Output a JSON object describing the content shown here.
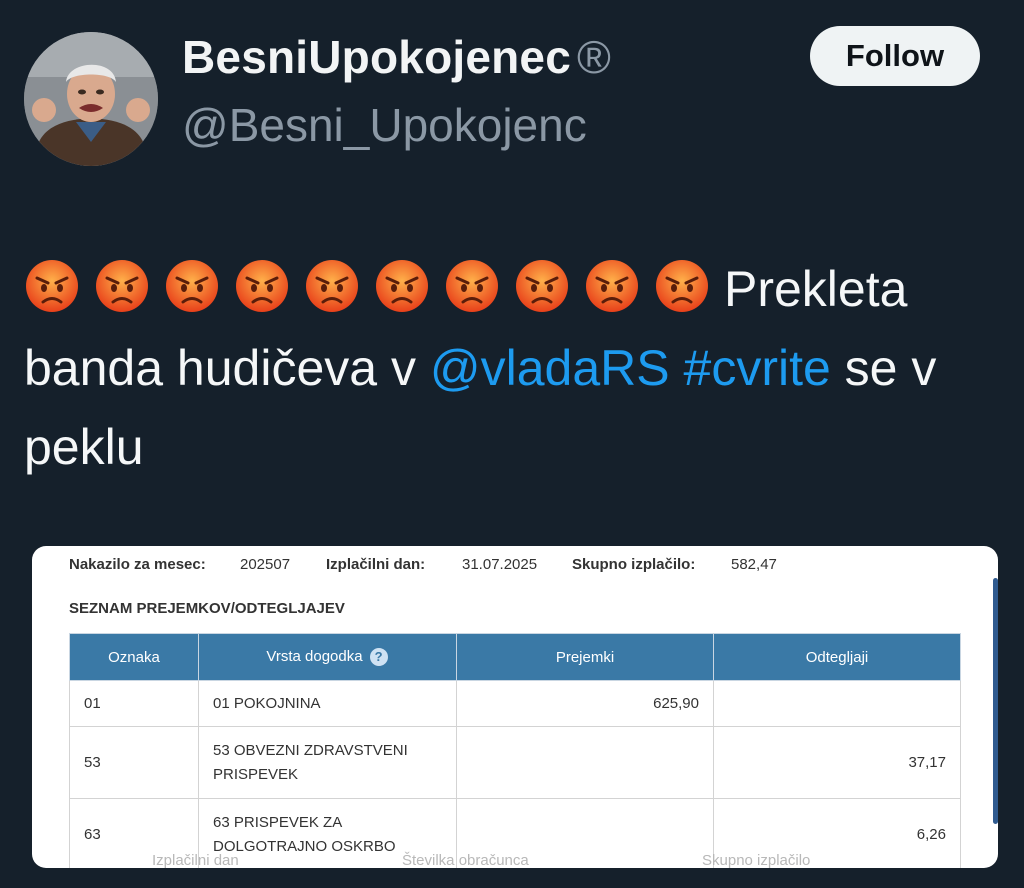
{
  "profile": {
    "display_name": "BesniUpokojenec",
    "verified_symbol": "®",
    "handle": "@Besni_Upokojenc",
    "follow_label": "Follow"
  },
  "tweet": {
    "emoji_count": 10,
    "emoji_name": "pouting-face",
    "text_1": "Prekleta banda hudičeva v ",
    "mention": "@vladaRS",
    "hashtag": "#cvrite",
    "text_2": " se v peklu"
  },
  "colors": {
    "background": "#15202b",
    "link": "#1d9bf0",
    "table_header": "#3a79a6"
  },
  "document": {
    "meta": {
      "month_label": "Nakazilo za mesec:",
      "month_value": "202507",
      "payday_label": "Izplačilni dan:",
      "payday_value": "31.07.2025",
      "total_label": "Skupno izplačilo:",
      "total_value": "582,47"
    },
    "section_title": "SEZNAM PREJEMKOV/ODTEGLJAJEV",
    "columns": [
      "Oznaka",
      "Vrsta dogodka",
      "Prejemki",
      "Odtegljaji"
    ],
    "rows": [
      {
        "code": "01",
        "type_line1": "01 POKOJNINA",
        "type_line2": "",
        "income": "625,90",
        "deduction": ""
      },
      {
        "code": "53",
        "type_line1": "53 OBVEZNI ZDRAVSTVENI",
        "type_line2": "PRISPEVEK",
        "income": "",
        "deduction": "37,17"
      },
      {
        "code": "63",
        "type_line1": "63 PRISPEVEK ZA",
        "type_line2": "DOLGOTRAJNO OSKRBO",
        "income": "",
        "deduction": "6,26"
      }
    ],
    "footer_partial": [
      "Izplačilni dan",
      "Številka obračunca",
      "Skupno izplačilo"
    ]
  }
}
